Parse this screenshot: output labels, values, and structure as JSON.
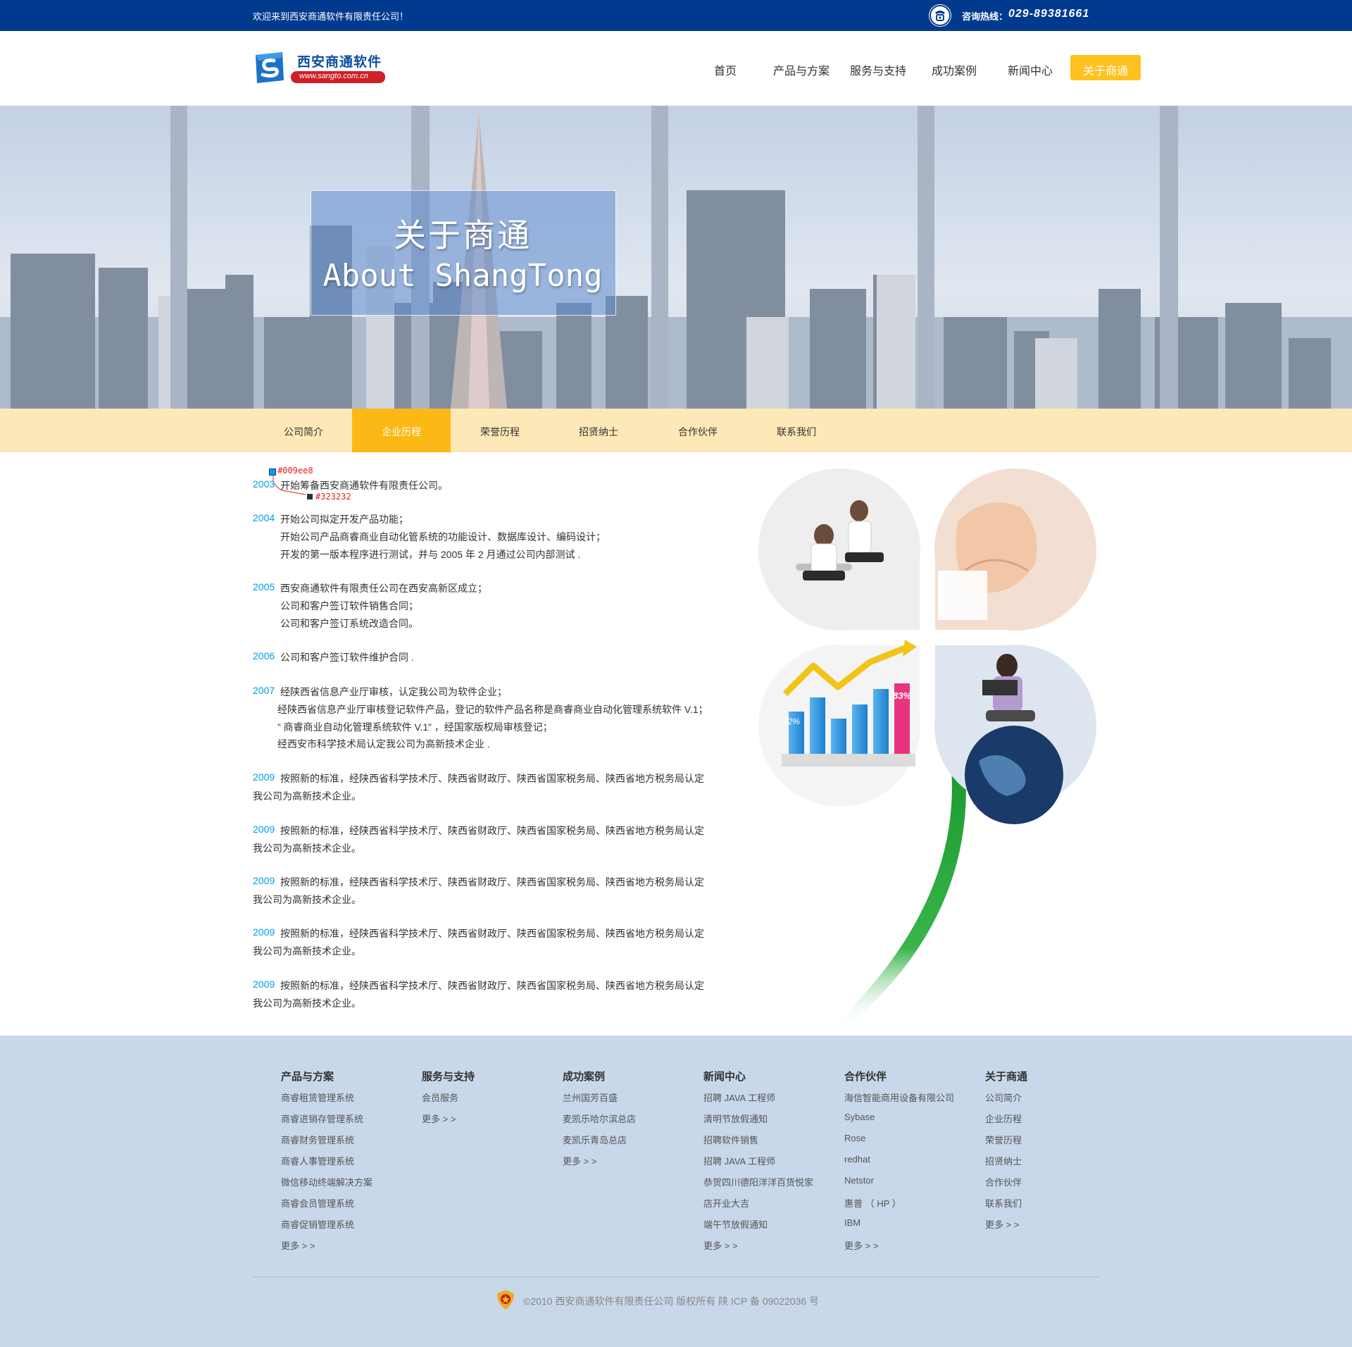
{
  "topbar": {
    "welcome": "欢迎来到西安商通软件有限责任公司！",
    "hotline_label": "咨询热线：",
    "hotline_number": "029-89381661"
  },
  "logo": {
    "name": "西安商通软件",
    "url": "www.sangto.com.cn"
  },
  "nav": {
    "items": [
      "首页",
      "产品与方案",
      "服务与支持",
      "成功案例",
      "新闻中心",
      "关于商通"
    ]
  },
  "hero": {
    "title_cn": "关于商通",
    "title_en": "About ShangTong"
  },
  "subnav": {
    "items": [
      "公司简介",
      "企业历程",
      "荣誉历程",
      "招贤纳士",
      "合作伙伴",
      "联系我们"
    ]
  },
  "spec_notes": {
    "year_color": "#009ee8",
    "text_color": "#323232"
  },
  "history": [
    {
      "year": "2003",
      "lines": [
        "开始筹备西安商通软件有限责任公司。"
      ]
    },
    {
      "year": "2004",
      "lines": [
        "开始公司拟定开发产品功能；",
        "开始公司产品商睿商业自动化管系统的功能设计、数据库设计、编码设计；",
        "开发的第一版本程序进行测试，并与 2005 年 2 月通过公司内部测试 ."
      ]
    },
    {
      "year": "2005",
      "lines": [
        "西安商通软件有限责任公司在西安高新区成立；",
        "公司和客户签订软件销售合同；",
        "公司和客户签订系统改造合同。"
      ]
    },
    {
      "year": "2006",
      "lines": [
        "公司和客户签订软件维护合同 ."
      ]
    },
    {
      "year": "2007",
      "lines": [
        "经陕西省信息产业厅审核，认定我公司为软件企业；",
        "经陕西省信息产业厅审核登记软件产品，登记的软件产品名称是商睿商业自动化管理系统软件 V.1；",
        "” 商睿商业自动化管理系统软件 V.1” ，经国家版权局审核登记；",
        "经西安市科学技术局认定我公司为高新技术企业 ."
      ]
    },
    {
      "year": "2009",
      "lines": [
        "按照新的标准，经陕西省科学技术厅、陕西省财政厅、陕西省国家税务局、陕西省地方税务局认定",
        "我公司为高新技术企业。"
      ]
    },
    {
      "year": "2009",
      "lines": [
        "按照新的标准，经陕西省科学技术厅、陕西省财政厅、陕西省国家税务局、陕西省地方税务局认定",
        "我公司为高新技术企业。"
      ]
    },
    {
      "year": "2009",
      "lines": [
        "按照新的标准，经陕西省科学技术厅、陕西省财政厅、陕西省国家税务局、陕西省地方税务局认定",
        "我公司为高新技术企业。"
      ]
    },
    {
      "year": "2009",
      "lines": [
        "按照新的标准，经陕西省科学技术厅、陕西省财政厅、陕西省国家税务局、陕西省地方税务局认定",
        "我公司为高新技术企业。"
      ]
    },
    {
      "year": "2009",
      "lines": [
        "按照新的标准，经陕西省科学技术厅、陕西省财政厅、陕西省国家税务局、陕西省地方税务局认定",
        "我公司为高新技术企业。"
      ]
    }
  ],
  "chart_labels": {
    "low": "12%",
    "high": "83%"
  },
  "footer": {
    "columns": [
      {
        "title": "产品与方案",
        "links": [
          "商睿租赁管理系统",
          "商睿进销存管理系统",
          "商睿财务管理系统",
          "商睿人事管理系统",
          "微信移动终端解决方案",
          "商睿会员管理系统",
          "商睿促销管理系统",
          "更多 > >"
        ]
      },
      {
        "title": "服务与支持",
        "links": [
          "会员服务",
          "更多 > >"
        ]
      },
      {
        "title": "成功案例",
        "links": [
          "兰州国芳百盛",
          "麦凯乐哈尔滨总店",
          "麦凯乐青岛总店",
          "更多 > >"
        ]
      },
      {
        "title": "新闻中心",
        "links": [
          "招聘 JAVA 工程师",
          "清明节放假通知",
          "招聘软件销售",
          "招聘 JAVA 工程师",
          "恭贺四川德阳洋洋百货悦家",
          "店开业大吉",
          "端午节放假通知",
          "更多 > >"
        ]
      },
      {
        "title": "合作伙伴",
        "links": [
          "海信智能商用设备有限公司",
          "Sybase",
          "Rose",
          "redhat",
          "Netstor",
          "惠普 （ HP ）",
          "IBM",
          "更多 > >"
        ]
      },
      {
        "title": "关于商通",
        "links": [
          "公司简介",
          "企业历程",
          "荣誉历程",
          "招贤纳士",
          "合作伙伴",
          "联系我们",
          "更多 > >"
        ]
      }
    ],
    "copyright": "©2010 西安商通软件有限责任公司 版权所有    陕 ICP 备 09022036 号"
  }
}
